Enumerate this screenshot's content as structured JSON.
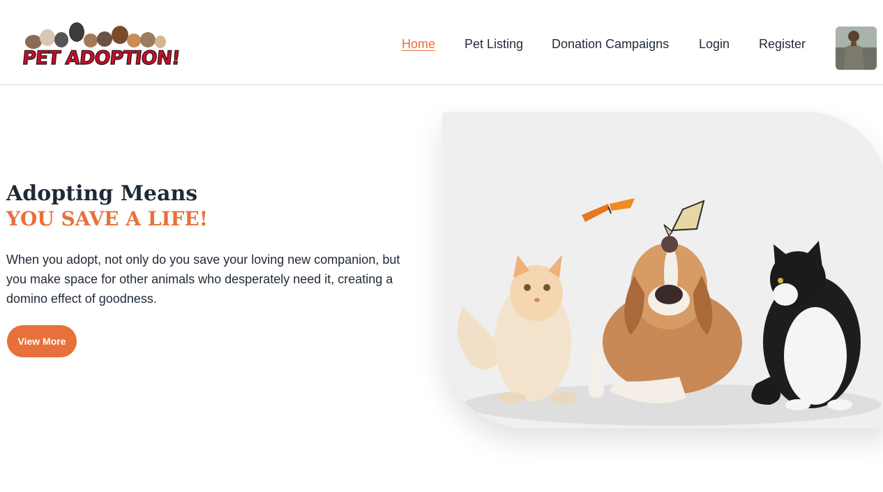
{
  "header": {
    "logo_text": "PET ADOPTION!",
    "nav": [
      {
        "label": "Home",
        "active": true
      },
      {
        "label": "Pet Listing",
        "active": false
      },
      {
        "label": "Donation Campaigns",
        "active": false
      },
      {
        "label": "Login",
        "active": false
      },
      {
        "label": "Register",
        "active": false
      }
    ]
  },
  "hero": {
    "title": "Adopting Means",
    "accent": "YOU SAVE A LIFE!",
    "description": "When you adopt, not only do you save your loving new companion, but you make space for other animals who desperately need it, creating a domino effect of goodness.",
    "button_label": "View More"
  },
  "colors": {
    "accent": "#e8703a",
    "text": "#1f2a37",
    "logo_red": "#c8102e"
  }
}
